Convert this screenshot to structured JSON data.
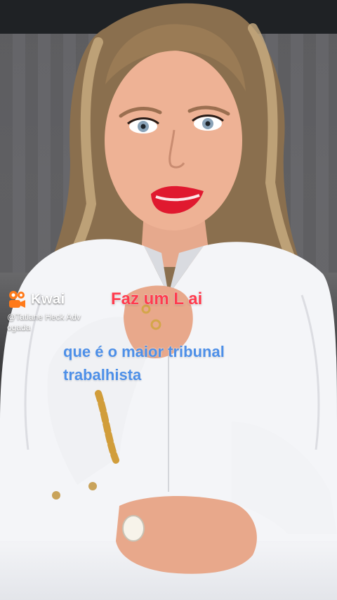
{
  "watermark": {
    "brand": "Kwai",
    "handle_line1": "@Tatiane Heck Adv",
    "handle_line2": "ogada",
    "icon": "kwai-logo-icon",
    "brand_color": "#ff7a1a"
  },
  "captions": {
    "top_line": "Faz um L ai",
    "lines": [
      "que é o maior tribunal",
      "trabalhista"
    ],
    "top_color": "#ff3b4e",
    "lines_color": "#4d8fe8"
  }
}
